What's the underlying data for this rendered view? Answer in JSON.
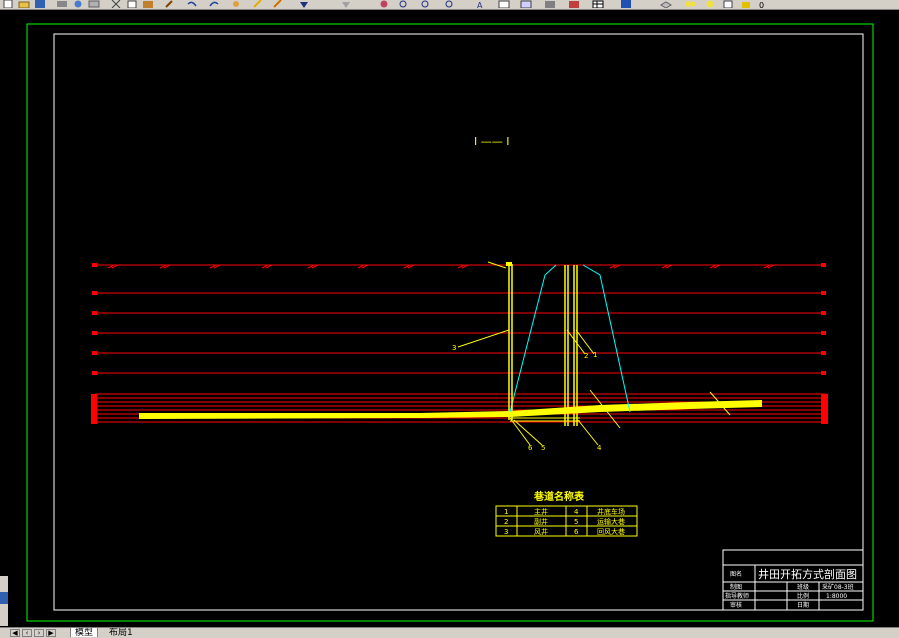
{
  "section_title": "I —— I",
  "labels": [
    "3",
    "2",
    "1",
    "6",
    "5",
    "4"
  ],
  "legend": {
    "title": "巷道名称表",
    "rows": [
      [
        "1",
        "主井",
        "4",
        "井底车场"
      ],
      [
        "2",
        "副井",
        "5",
        "运输大巷"
      ],
      [
        "3",
        "风井",
        "6",
        "回风大巷"
      ]
    ]
  },
  "title_block": {
    "drawing_title": "井田开拓方式剖面图",
    "r1_label": "图名",
    "r2": [
      "制图",
      "",
      "班级",
      "采矿08-3班"
    ],
    "r3": [
      "指导教师",
      "",
      "比例",
      "1:8000"
    ],
    "r4": [
      "审核",
      "",
      "日期",
      ""
    ]
  },
  "tabs": {
    "model": "模型",
    "layout": "布局1"
  },
  "colors": {
    "background": "#000000",
    "outer_border": "#00ff00",
    "inner_border": "#ffffff",
    "strata": "#ff0000",
    "coal_seam": "#ffff00",
    "shaft": "#ffff00",
    "slope": "#00ffff"
  }
}
